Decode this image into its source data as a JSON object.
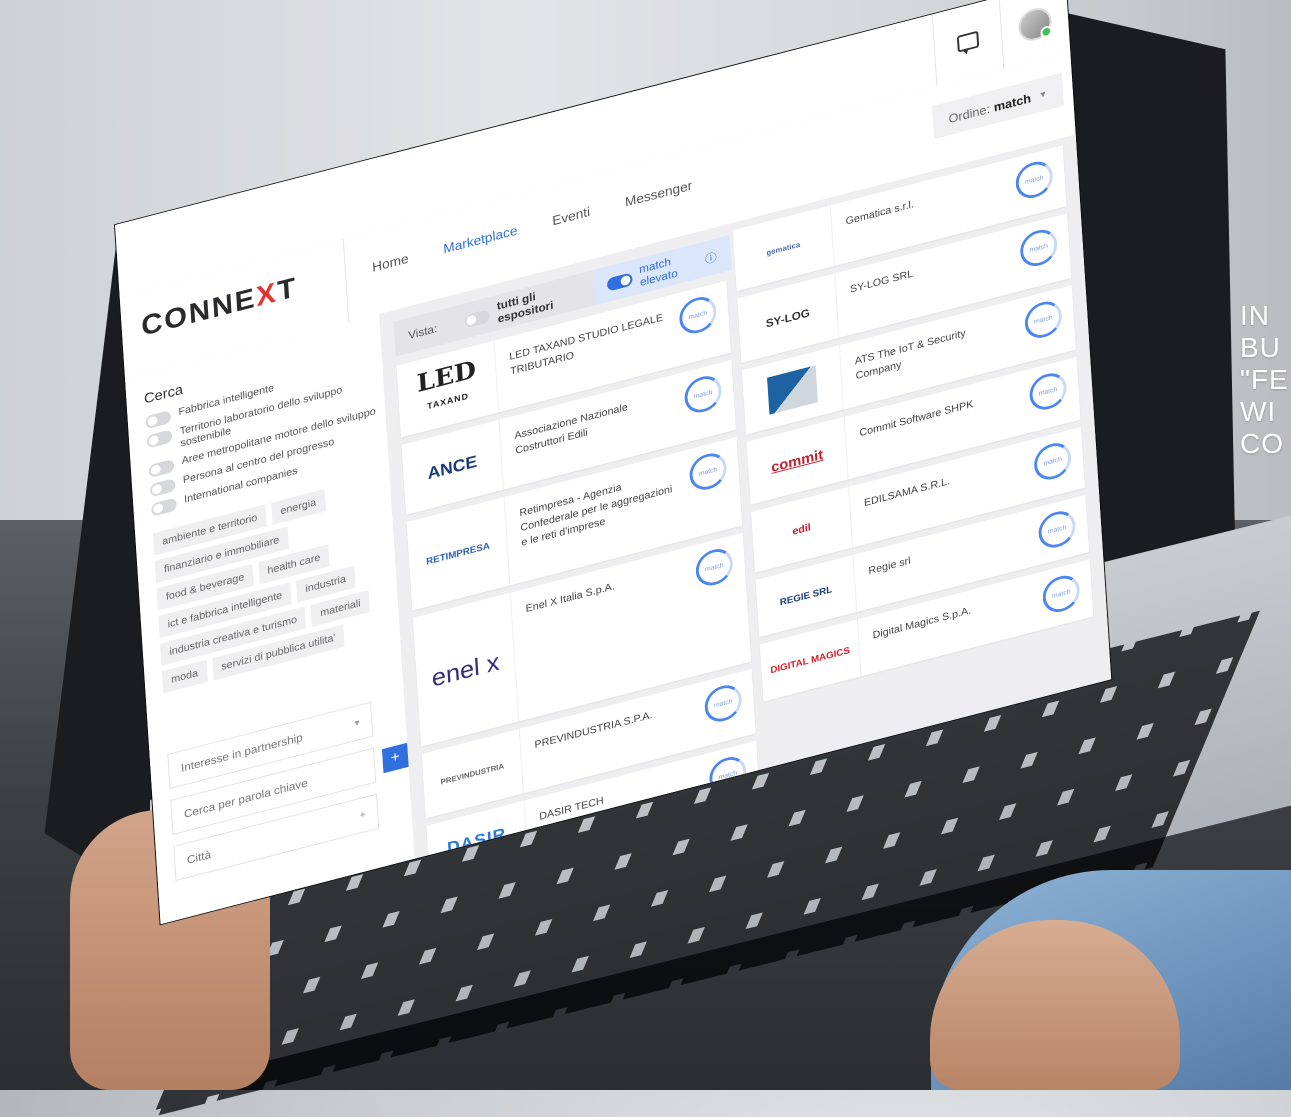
{
  "overlay_text": "IN\nBU\n\"FE\nWI\nCO",
  "header": {
    "logo_main": "CONNE",
    "logo_x": "X",
    "logo_end": "T",
    "nav": [
      "Home",
      "Marketplace",
      "Eventi",
      "Messenger"
    ],
    "active_nav": "Marketplace",
    "order_label": "Ordine:",
    "order_value": "match"
  },
  "search": {
    "title": "Cerca",
    "toggles": [
      "Fabbrica intelligente",
      "Territorio laboratorio dello sviluppo sostenibile",
      "Aree metropolitane motore dello sviluppo",
      "Persona al centro del progresso",
      "International companies"
    ],
    "tags": [
      "ambiente e territorio",
      "energia",
      "finanziario e immobiliare",
      "food & beverage",
      "health care",
      "ict e fabbrica intelligente",
      "industria",
      "industria creativa e turismo",
      "materiali",
      "moda",
      "servizi di pubblica utilita'"
    ],
    "partnership_placeholder": "Interesse in partnership",
    "keyword_placeholder": "Cerca per parola chiave",
    "city_placeholder": "Città",
    "add_label": "+"
  },
  "view": {
    "label": "Vista:",
    "option_all": "tutti gli espositori",
    "option_match": "match elevato"
  },
  "match_label": "match",
  "results_left": [
    {
      "name": "LED TAXAND STUDIO LEGALE TRIBUTARIO",
      "logo": "LED",
      "logo_sub": "TAXAND"
    },
    {
      "name": "Associazione Nazionale Costruttori Edili",
      "logo": "ANCE"
    },
    {
      "name": "Retimpresa - Agenzia Confederale per le aggregazioni e le reti d'imprese",
      "logo": "RETIMPRESA"
    },
    {
      "name": "Enel X Italia S.p.A.",
      "logo": "enel x"
    },
    {
      "name": "PREVINDUSTRIA S.P.A.",
      "logo": "PREVINDUSTRIA"
    },
    {
      "name": "DASIR TECH",
      "logo": "DASIR"
    }
  ],
  "results_right": [
    {
      "name": "Gematica s.r.l.",
      "logo": "gematica"
    },
    {
      "name": "SY-LOG SRL",
      "logo": "SY-LOG"
    },
    {
      "name": "ATS The IoT & Security Company",
      "logo": ""
    },
    {
      "name": "Commit Software SHPK",
      "logo": "commit"
    },
    {
      "name": "EDILSAMA S.R.L.",
      "logo": "edil"
    },
    {
      "name": "Regie srl",
      "logo": "REGIE SRL"
    },
    {
      "name": "Digital Magics S.p.A.",
      "logo": "DIGITAL MAGICS"
    }
  ]
}
